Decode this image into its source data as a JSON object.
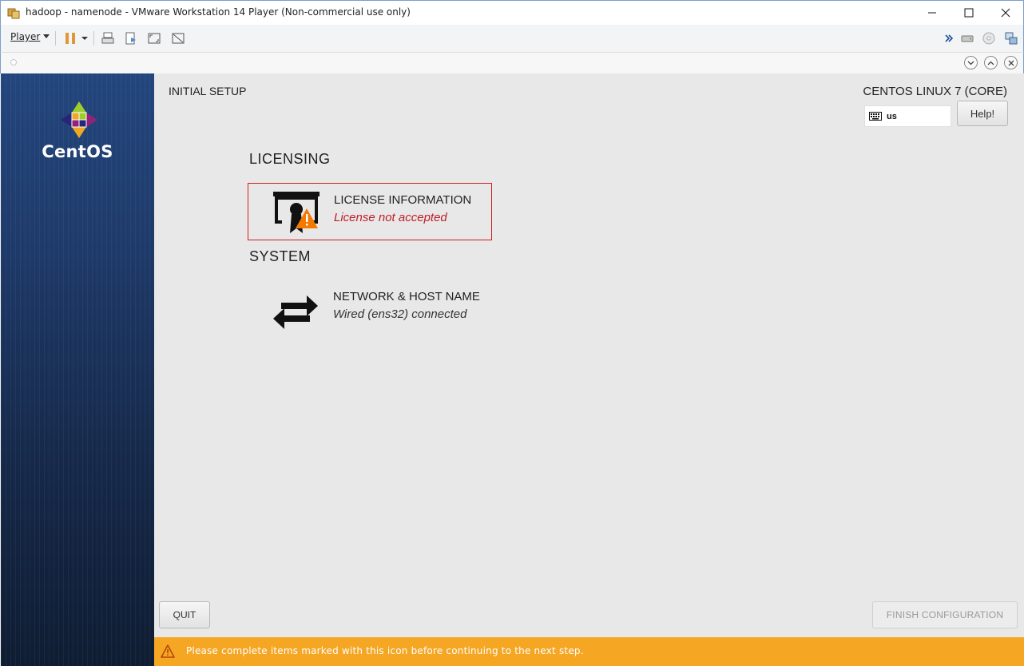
{
  "window": {
    "title": "hadoop - namenode - VMware Workstation 14 Player (Non-commercial use only)",
    "icon": "vmware-player-icon"
  },
  "toolbar": {
    "player_menu_label": "Player"
  },
  "sidebar": {
    "brand": "CentOS"
  },
  "header": {
    "initial_setup": "INITIAL SETUP",
    "product": "CENTOS LINUX 7 (CORE)",
    "keyboard_layout": "us",
    "help_label": "Help!"
  },
  "sections": [
    {
      "title": "LICENSING",
      "spokes": [
        {
          "name": "LICENSE INFORMATION",
          "status": "License not accepted",
          "state": "warning"
        }
      ]
    },
    {
      "title": "SYSTEM",
      "spokes": [
        {
          "name": "NETWORK & HOST NAME",
          "status": "Wired (ens32) connected",
          "state": "ok"
        }
      ]
    }
  ],
  "buttons": {
    "quit": "QUIT",
    "finish": "FINISH CONFIGURATION"
  },
  "warning_bar": {
    "message": "Please complete items marked with this icon before continuing to the next step."
  },
  "colors": {
    "warning_bar": "#f5a623",
    "error_text": "#c01c28",
    "sidebar_top": "#23467e",
    "sidebar_bottom": "#0f1d33"
  }
}
